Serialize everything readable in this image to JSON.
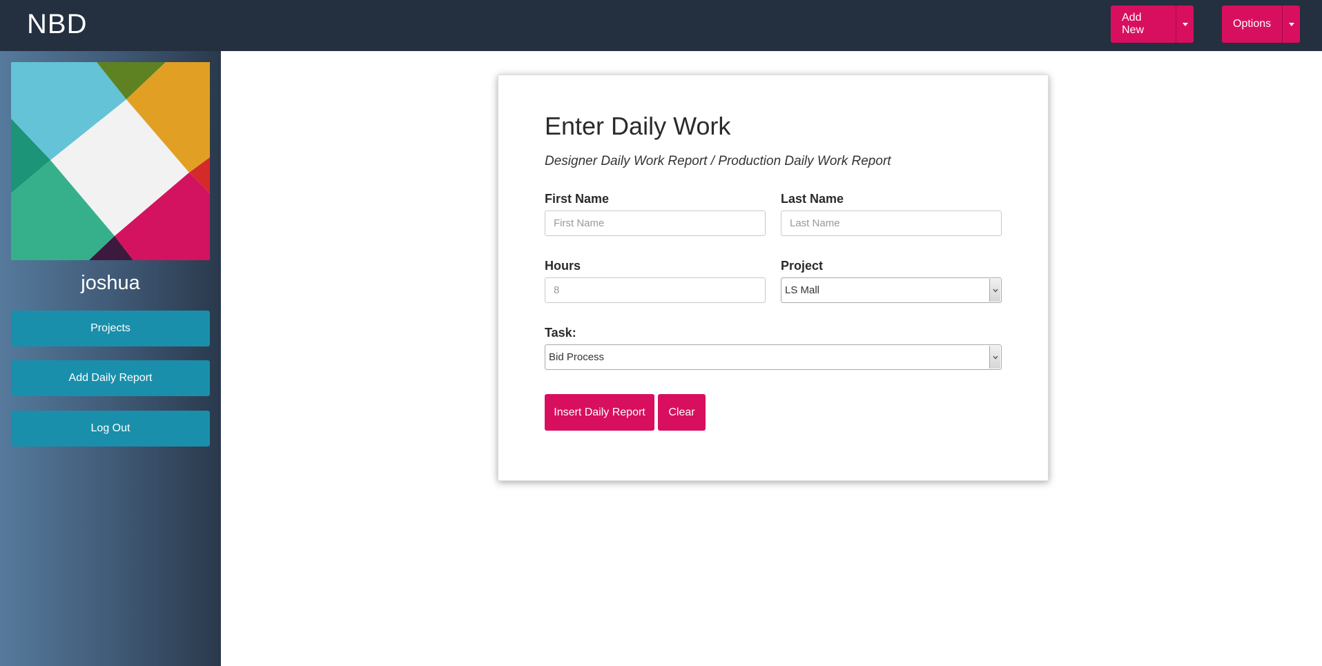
{
  "navbar": {
    "brand": "NBD",
    "add_new_label": "Add New",
    "options_label": "Options"
  },
  "sidebar": {
    "username": "joshua",
    "items": [
      {
        "label": "Projects"
      },
      {
        "label": "Add Daily Report"
      },
      {
        "label": "Log Out"
      }
    ]
  },
  "form": {
    "title": "Enter Daily Work",
    "subtitle": "Designer Daily Work Report / Production Daily Work Report",
    "first_name": {
      "label": "First Name",
      "placeholder": "First Name"
    },
    "last_name": {
      "label": "Last Name",
      "placeholder": "Last Name"
    },
    "hours": {
      "label": "Hours",
      "placeholder": "8"
    },
    "project": {
      "label": "Project",
      "selected": "LS Mall"
    },
    "task": {
      "label": "Task:",
      "selected": "Bid Process"
    },
    "insert_label": "Insert Daily Report",
    "clear_label": "Clear"
  },
  "colors": {
    "navbar": "#24303f",
    "accent": "#d80f5f",
    "sidebar_button": "#1a8fab"
  }
}
